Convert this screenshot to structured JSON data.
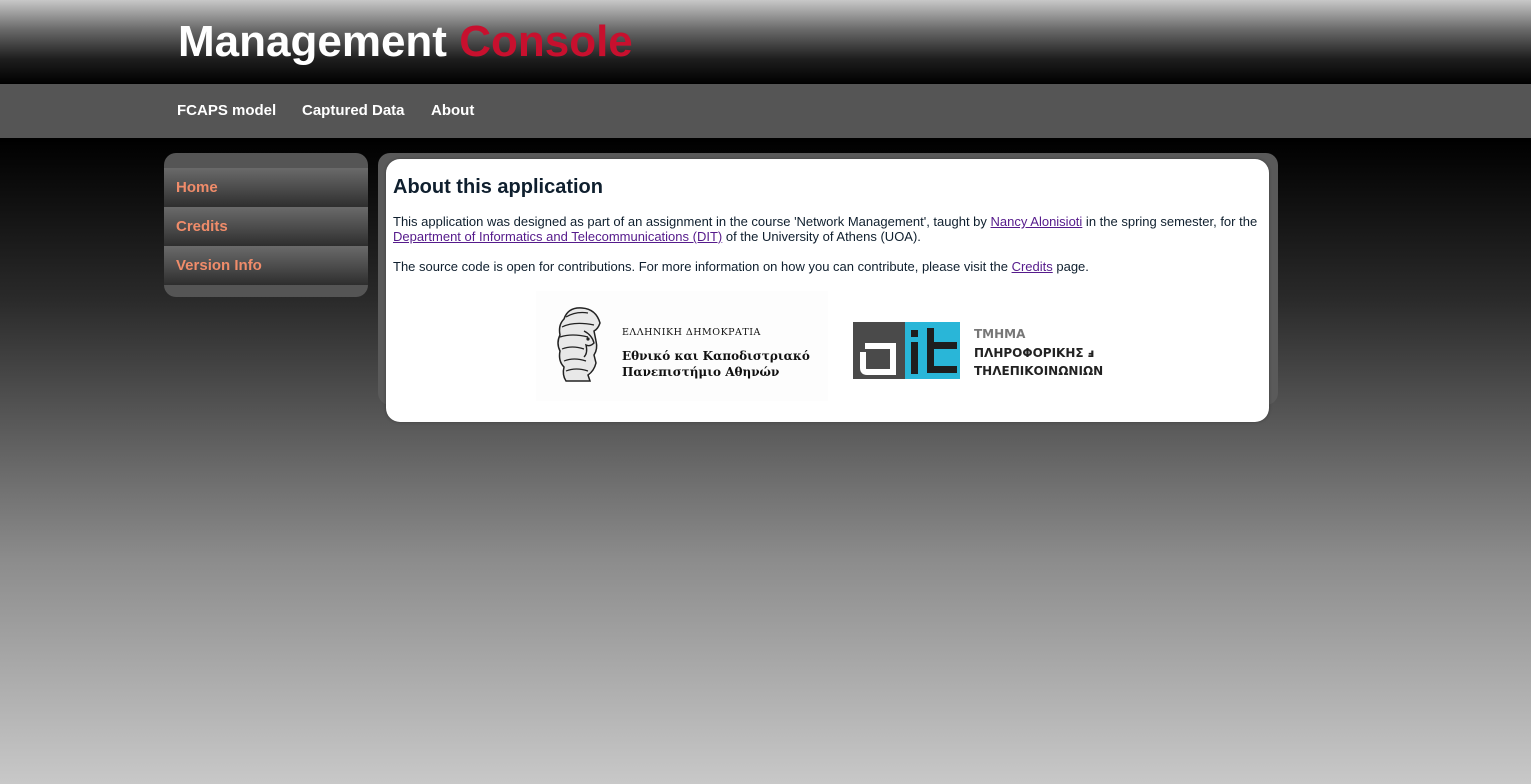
{
  "header": {
    "title_main": "Management",
    "title_accent": "Console",
    "accent_color": "#c8102e"
  },
  "topnav": {
    "items": [
      {
        "label": "FCAPS model"
      },
      {
        "label": "Captured Data"
      },
      {
        "label": "About"
      }
    ]
  },
  "sidebar": {
    "items": [
      {
        "label": "Home"
      },
      {
        "label": "Credits"
      },
      {
        "label": "Version Info"
      }
    ],
    "link_color": "#f08c6a"
  },
  "main": {
    "heading": "About this application",
    "p1_before": "This application was designed as part of an assignment in the course 'Network Management', taught by ",
    "p1_link1": "Nancy Alonisioti",
    "p1_mid": " in the spring semester, for the ",
    "p1_link2": "Department of Informatics and Telecommunications (DIT)",
    "p1_after": " of the University of Athens (UOA).",
    "p2_before": "The source code is open for contributions. For more information on how you can contribute, please visit the ",
    "p2_link": "Credits",
    "p2_after": " page."
  },
  "logos": {
    "uoa": {
      "line_small": "ΕΛΛΗΝΙΚΗ ΔΗΜΟΚΡΑΤΙΑ",
      "line1": "Εθνικό και Καποδιστριακό",
      "line2": "Πανεπιστήμιο Αθηνών"
    },
    "dit": {
      "line1": "ΤΜΗΜΑ",
      "line2": "ΠΛΗΡΟΦΟΡΙΚΗΣ ⅎ",
      "line3": "ΤΗΛΕΠΙΚΟΙΝΩΝΙΩΝ",
      "accent_color": "#29b6d8"
    }
  }
}
